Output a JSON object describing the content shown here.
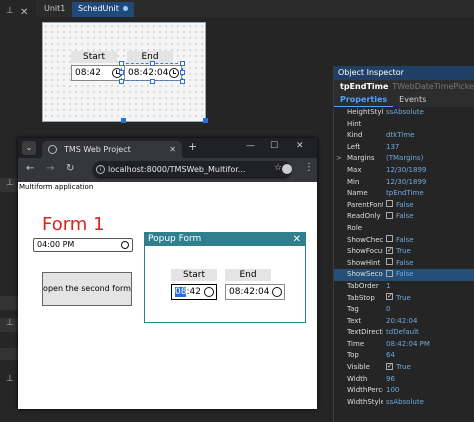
{
  "ide": {
    "tabs": [
      "Unit1",
      "SchedUnit"
    ]
  },
  "designer": {
    "start_label": "Start",
    "end_label": "End",
    "start_time": "08:42",
    "end_time": "08:42:04"
  },
  "inspector": {
    "title": "Object Inspector",
    "component_name": "tpEndTime",
    "component_class": "TWebDateTimePicker",
    "tabs": [
      "Properties",
      "Events"
    ],
    "rows": [
      {
        "exp": "",
        "name": "HeightStyle",
        "value": "ssAbsolute"
      },
      {
        "exp": "",
        "name": "Hint",
        "value": ""
      },
      {
        "exp": "",
        "name": "Kind",
        "value": "dtkTime"
      },
      {
        "exp": "",
        "name": "Left",
        "value": "137"
      },
      {
        "exp": ">",
        "name": "Margins",
        "value": "(TMargins)"
      },
      {
        "exp": "",
        "name": "Max",
        "value": "12/30/1899"
      },
      {
        "exp": "",
        "name": "Min",
        "value": "12/30/1899"
      },
      {
        "exp": "",
        "name": "Name",
        "value": "tpEndTime"
      },
      {
        "exp": "",
        "name": "ParentFont",
        "value": "False",
        "check": false
      },
      {
        "exp": "",
        "name": "ReadOnly",
        "value": "False",
        "check": false
      },
      {
        "exp": "",
        "name": "Role",
        "value": ""
      },
      {
        "exp": "",
        "name": "ShowCheckBox",
        "value": "False",
        "check": false
      },
      {
        "exp": "",
        "name": "ShowFocus",
        "value": "True",
        "check": true
      },
      {
        "exp": "",
        "name": "ShowHint",
        "value": "False",
        "check": false
      },
      {
        "exp": "",
        "name": "ShowSeconds",
        "value": "False",
        "check": false,
        "selected": true
      },
      {
        "exp": "",
        "name": "TabOrder",
        "value": "1"
      },
      {
        "exp": "",
        "name": "TabStop",
        "value": "True",
        "check": true
      },
      {
        "exp": "",
        "name": "Tag",
        "value": "0"
      },
      {
        "exp": "",
        "name": "Text",
        "value": "20:42:04"
      },
      {
        "exp": "",
        "name": "TextDirection",
        "value": "tdDefault"
      },
      {
        "exp": "",
        "name": "Time",
        "value": "08:42:04 PM"
      },
      {
        "exp": "",
        "name": "Top",
        "value": "64"
      },
      {
        "exp": "",
        "name": "Visible",
        "value": "True",
        "check": true
      },
      {
        "exp": "",
        "name": "Width",
        "value": "96"
      },
      {
        "exp": "",
        "name": "WidthPercent",
        "value": "100"
      },
      {
        "exp": "",
        "name": "WidthStyle",
        "value": "ssAbsolute"
      }
    ]
  },
  "browser": {
    "tab_title": "TMS Web Project",
    "url": "localhost:8000/TMSWeb_Multifor...",
    "app_label": "Multiform application",
    "form_title": "Form 1",
    "time_value": "04:00  PM",
    "second_button": "open the second form",
    "popup": {
      "title": "Popup Form",
      "start_label": "Start",
      "end_label": "End",
      "start_hour": "08",
      "start_rest": ":42",
      "end_time": "08:42:04"
    }
  }
}
